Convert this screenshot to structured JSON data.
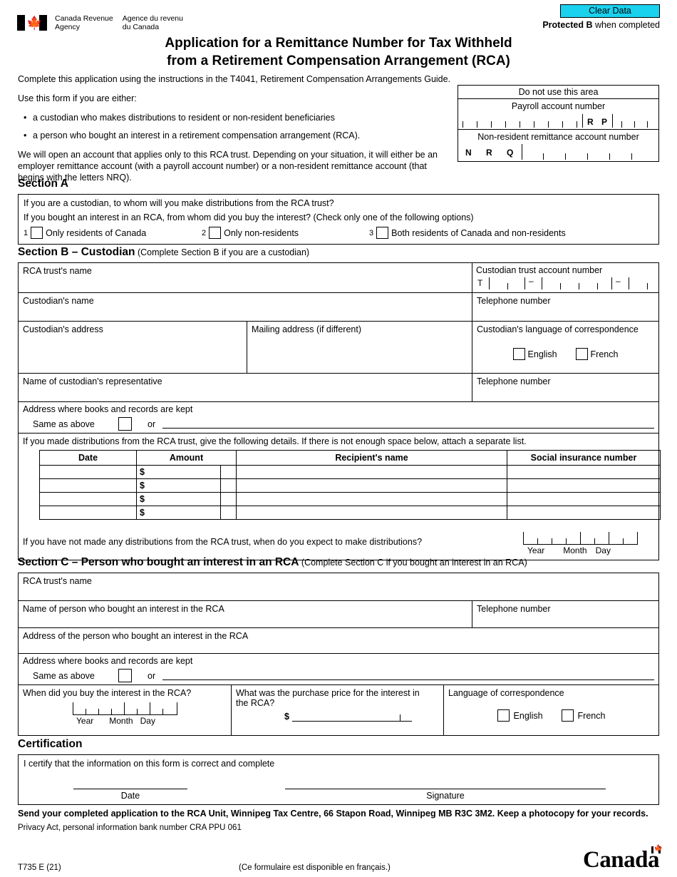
{
  "header": {
    "clear_data_label": "Clear Data",
    "protected_bold": "Protected B",
    "protected_rest": " when completed",
    "agency_en_line1": "Canada Revenue",
    "agency_en_line2": "Agency",
    "agency_fr_line1": "Agence du revenu",
    "agency_fr_line2": "du Canada",
    "title_line1": "Application for a Remittance Number for Tax Withheld",
    "title_line2": "from a Retirement Compensation Arrangement (RCA)",
    "clear_button_color": "#1ad1ee"
  },
  "intro": {
    "p1": "Complete this application using the instructions in the T4041, Retirement Compensation Arrangements Guide.",
    "p2": "Use this form if you are either:",
    "bullet1": "a custodian who makes distributions to resident or non-resident beneficiaries",
    "bullet2": "a person who bought an interest in a retirement compensation arrangement (RCA).",
    "p3": "We will open an account that applies only to this RCA trust. Depending on your situation, it will either be an employer remittance account (with a payroll account number) or a non-resident remittance account (that begins with the letters NRQ)."
  },
  "do_not_use": {
    "header": "Do not use this area",
    "payroll_label": "Payroll account number",
    "payroll_rp_r": "R",
    "payroll_rp_p": "P",
    "nonresident_label": "Non-resident remittance account number",
    "nrq_n": "N",
    "nrq_r": "R",
    "nrq_q": "Q"
  },
  "section_a": {
    "heading": "Section A",
    "q1": "If you are a custodian, to whom will you make distributions from the RCA trust?",
    "q2": "If you bought an interest in an RCA, from whom did you buy the interest? (Check only one of the following options)",
    "options": [
      {
        "num": "1",
        "label": "Only residents of Canada"
      },
      {
        "num": "2",
        "label": "Only non-residents"
      },
      {
        "num": "3",
        "label": "Both residents of Canada and non-residents"
      }
    ]
  },
  "section_b": {
    "heading_bold": "Section B – Custodian",
    "heading_norm": " (Complete Section B if you are a custodian)",
    "rca_trust_name": "RCA trust's name",
    "custodian_trust_account_number": "Custodian trust account number",
    "trust_prefix": "T",
    "custodian_name": "Custodian's name",
    "telephone_number": "Telephone number",
    "custodian_address": "Custodian's address",
    "mailing_address": "Mailing address (if different)",
    "language_label": "Custodian's language of correspondence",
    "english": "English",
    "french": "French",
    "representative_name": "Name of custodian's representative",
    "telephone_number_2": "Telephone number",
    "books_records": "Address where books and records are kept",
    "same_as_above": "Same as above",
    "or": "or",
    "dist_instruction": "If you made distributions from the RCA trust, give the following details. If there is not enough space below, attach a separate list.",
    "table_headers": [
      "Date",
      "Amount",
      "Recipient's name",
      "Social insurance number"
    ],
    "amount_symbol": "$",
    "table_rows": [
      {
        "date": "",
        "amount": "",
        "recipient": "",
        "sin": ""
      },
      {
        "date": "",
        "amount": "",
        "recipient": "",
        "sin": ""
      },
      {
        "date": "",
        "amount": "",
        "recipient": "",
        "sin": ""
      },
      {
        "date": "",
        "amount": "",
        "recipient": "",
        "sin": ""
      }
    ],
    "expect_question": "If you have not made any distributions from the RCA trust, when do you expect to make distributions?",
    "date_year": "Year",
    "date_month": "Month",
    "date_day": "Day"
  },
  "section_c": {
    "heading_bold": "Section C – Person who bought an interest in an RCA",
    "heading_norm": " (Complete Section C if you bought an interest in an RCA)",
    "rca_trust_name": "RCA trust's name",
    "person_name": "Name of person who bought an interest in the RCA",
    "telephone_number": "Telephone number",
    "person_address": "Address of the person who bought an interest in the RCA",
    "books_records": "Address where books and records are kept",
    "same_as_above": "Same as above",
    "or": "or",
    "when_bought": "When did you buy the interest in the RCA?",
    "date_year": "Year",
    "date_month": "Month",
    "date_day": "Day",
    "purchase_price_line1": "What was the purchase price for the interest in",
    "purchase_price_line2": "the RCA?",
    "dollar_symbol": "$",
    "language_label": "Language of correspondence",
    "english": "English",
    "french": "French"
  },
  "certification": {
    "heading": "Certification",
    "statement": "I certify that the information on this form is correct and complete",
    "date_label": "Date",
    "signature_label": "Signature"
  },
  "footer": {
    "send_instruction": "Send your completed application to the RCA Unit, Winnipeg Tax Centre, 66 Stapon Road, Winnipeg MB  R3C 3M2. Keep a photocopy for your records.",
    "privacy": "Privacy Act, personal information bank number CRA PPU 061",
    "form_code": "T735 E (21)",
    "french_note": "(Ce formulaire est disponible en français.)",
    "wordmark": "Canada"
  }
}
